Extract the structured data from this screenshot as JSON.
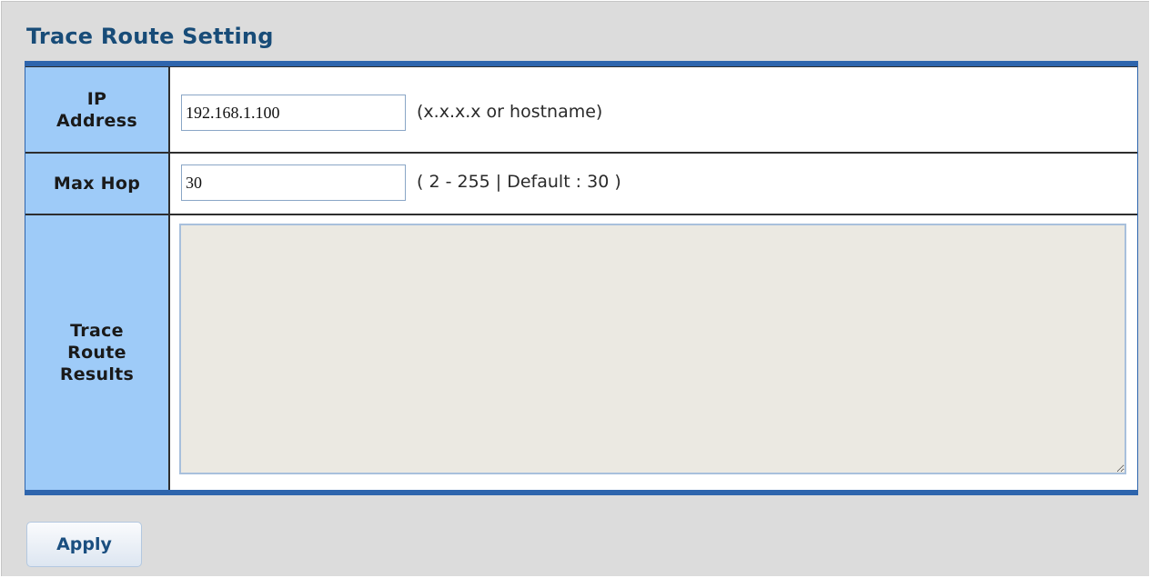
{
  "title": "Trace Route Setting",
  "form": {
    "ip_address": {
      "label_line1": "IP",
      "label_line2": "Address",
      "value": "192.168.1.100",
      "hint": "(x.x.x.x or hostname)"
    },
    "max_hop": {
      "label": "Max Hop",
      "value": "30",
      "hint": "( 2 - 255 | Default : 30 )"
    },
    "results": {
      "label_line1": "Trace",
      "label_line2": "Route",
      "label_line3": "Results",
      "value": ""
    }
  },
  "apply_label": "Apply",
  "colors": {
    "header_bar": "#2e65ad",
    "label_bg": "#9ecbf8",
    "title": "#184c78",
    "page_bg": "#dcdcdc"
  }
}
